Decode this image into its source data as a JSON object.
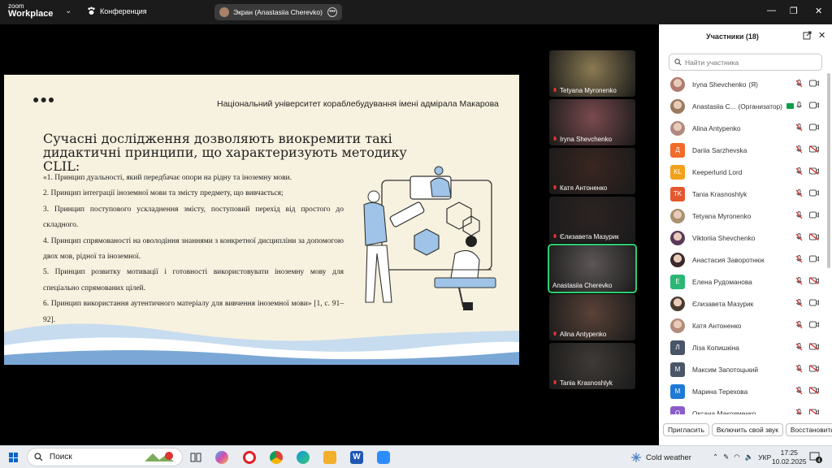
{
  "titlebar": {
    "logo_line1": "zoom",
    "logo_line2": "Workplace",
    "meeting_label": "Конференция",
    "share_label": "Экран (Anastasiia Cherevko)",
    "min_glyph": "—",
    "max_glyph": "❐",
    "close_glyph": "✕"
  },
  "slide": {
    "dots": "●●●",
    "university": "Національний університет кораблебудування імені адмірала Макарова",
    "title": "Сучасні дослідження дозволяють виокремити такі дидактичні принципи, що характеризують методику CLIL:",
    "paragraphs": [
      "«1. Принцип дуальності, який передбачає опори на рідну та іноземну мови.",
      " 2. Принцип інтеграції іноземної мови та змісту предмету, що вивчається;",
      "3. Принцип поступового ускладнення змісту, поступовий перехід від простого до складного.",
      "4. Принцип спрямованості на оволодіння знаннями з конкретної дисципліни за допомогою двох мов, рідної та іноземної.",
      " 5. Принцип розвитку мотивації і готовності використовувати іноземну мову для спеціально спрямованих цілей.",
      "6. Принцип використання аутентичного матеріалу для вивчення іноземної мови» [1, с. 91–92]."
    ]
  },
  "videos": [
    {
      "name": "Tetyana Myronenko",
      "bg": "#8a7a52"
    },
    {
      "name": "Iryna Shevchenko",
      "bg": "#7a4a4e"
    },
    {
      "name": "Катя Антоненко",
      "bg": "#3a2620"
    },
    {
      "name": "Єлизавета Мазурик",
      "bg": "#2c2322"
    },
    {
      "name": "Anastasiia Cherevko",
      "bg": "#5d5656",
      "active": true
    },
    {
      "name": "Alina Antypenko",
      "bg": "#5a4238"
    },
    {
      "name": "Tania Krasnoshlyk",
      "bg": "#3f3a36"
    }
  ],
  "panel": {
    "title": "Участники (18)",
    "search_placeholder": "Найти участника",
    "participants": [
      {
        "name": "Iryna Shevchenko",
        "role": "(Я)",
        "initial": "",
        "color": "#b07a70",
        "photo": true,
        "video_off": false
      },
      {
        "name": "Anastasiia C...",
        "role": "(Организатор)",
        "initial": "",
        "color": "#9b7a5e",
        "photo": true,
        "sharing": true,
        "mic_on": true,
        "video_off": false
      },
      {
        "name": "Alina Antypenko",
        "role": "",
        "initial": "",
        "color": "#b08a80",
        "photo": true,
        "video_off": false
      },
      {
        "name": "Dariia Sarzhevska",
        "role": "",
        "initial": "Д",
        "color": "#f26b2a",
        "video_off": true
      },
      {
        "name": "Keeperlurid Lord",
        "role": "",
        "initial": "KL",
        "color": "#f2a11a",
        "video_off": true
      },
      {
        "name": "Tania Krasnoshlyk",
        "role": "",
        "initial": "TK",
        "color": "#e4572e",
        "video_off": false
      },
      {
        "name": "Tetyana Myronenko",
        "role": "",
        "initial": "",
        "color": "#a89070",
        "photo": true,
        "video_off": false
      },
      {
        "name": "Viktoriia Shevchenko",
        "role": "",
        "initial": "",
        "color": "#5a3a5a",
        "photo": true,
        "video_off": true
      },
      {
        "name": "Анастасия Заворотнюк",
        "role": "",
        "initial": "",
        "color": "#3a2a2a",
        "photo": true,
        "video_off": false
      },
      {
        "name": "Елена Рудоманова",
        "role": "",
        "initial": "Е",
        "color": "#2bb673",
        "video_off": true
      },
      {
        "name": "Єлизавета Мазурик",
        "role": "",
        "initial": "",
        "color": "#4a3a30",
        "photo": true,
        "video_off": false
      },
      {
        "name": "Катя Антоненко",
        "role": "",
        "initial": "",
        "color": "#b48a7a",
        "photo": true,
        "video_off": false
      },
      {
        "name": "Ліза Копишкіна",
        "role": "",
        "initial": "Л",
        "color": "#4a5568",
        "video_off": true
      },
      {
        "name": "Максим Запотоцький",
        "role": "",
        "initial": "М",
        "color": "#4a5568",
        "video_off": true
      },
      {
        "name": "Марина Терехова",
        "role": "",
        "initial": "М",
        "color": "#1f7ad6",
        "video_off": true
      },
      {
        "name": "Оксана Макоименко",
        "role": "",
        "initial": "О",
        "color": "#8a5cc9",
        "video_off": true
      }
    ],
    "invite_label": "Пригласить",
    "unmute_label": "Включить свой звук",
    "restore_label": "Восстановить"
  },
  "taskbar": {
    "search_label": "Поиск",
    "weather": "Cold weather",
    "lang": "УКР",
    "time": "17:25",
    "date": "10.02.2025",
    "notif_count": "4"
  }
}
